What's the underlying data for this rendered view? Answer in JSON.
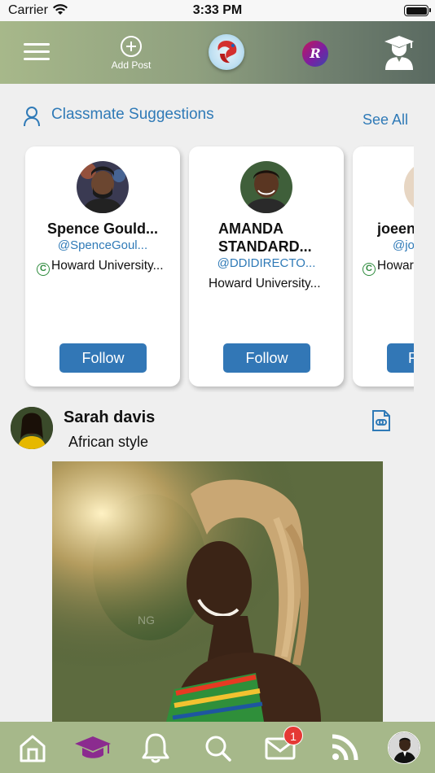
{
  "status_bar": {
    "carrier": "Carrier",
    "time": "3:33 PM"
  },
  "header": {
    "add_post_label": "Add Post",
    "r_badge_letter": "R",
    "icons": [
      "menu-icon",
      "add-post-icon",
      "app-logo",
      "r-badge",
      "graduate-user-icon"
    ]
  },
  "suggestions": {
    "title": "Classmate Suggestions",
    "see_all": "See All",
    "cards": [
      {
        "name": "Spence Gould...",
        "handle": "@SpenceGoul...",
        "school": "Howard University...",
        "verified": true,
        "follow": "Follow"
      },
      {
        "name": "AMANDA STANDARD...",
        "handle": "@DDIDIRECTO...",
        "school": "Howard University...",
        "verified": false,
        "follow": "Follow"
      },
      {
        "name": "joeen",
        "handle": "@jo",
        "school": "Howar",
        "verified": true,
        "follow": "F"
      }
    ]
  },
  "post": {
    "author": "Sarah davis",
    "text": "African style",
    "image_watermark": "NG"
  },
  "tab_bar": {
    "items": [
      "home-icon",
      "graduation-cap-icon",
      "bell-icon",
      "search-icon",
      "mail-icon",
      "rss-icon",
      "profile-avatar"
    ],
    "mail_badge": "1",
    "colors": {
      "bar": "#a6b88a",
      "accent": "#8b2b8f"
    }
  },
  "colors": {
    "link": "#2f7ab7",
    "button": "#3277b6",
    "header_start": "#a7b88a",
    "header_end": "#5a6a61"
  }
}
